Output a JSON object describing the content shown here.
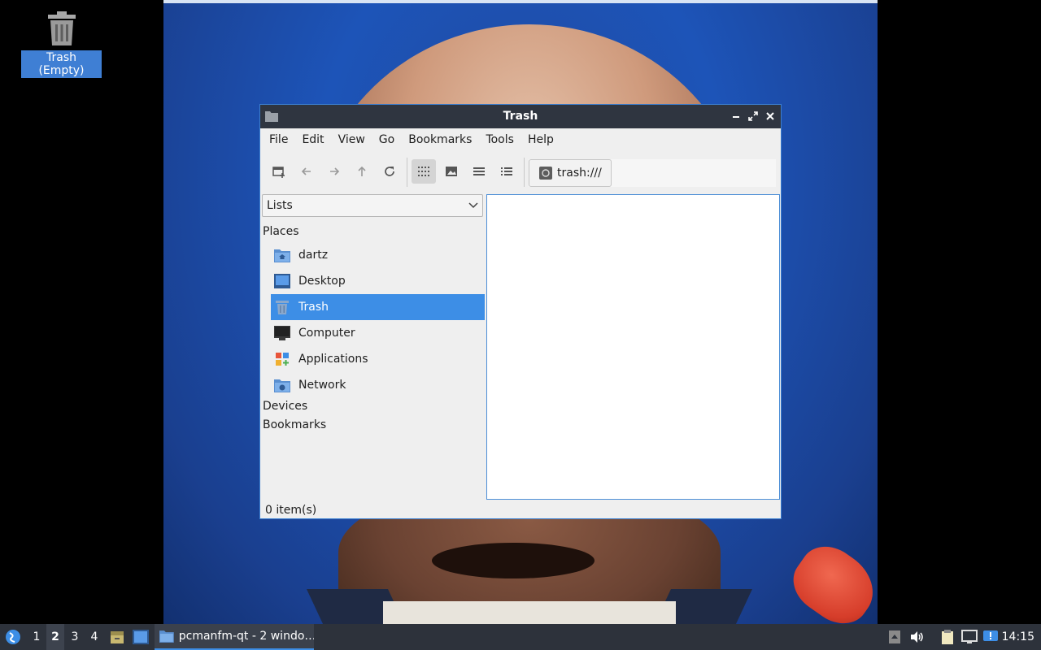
{
  "desktop": {
    "trash_icon_label": "Trash (Empty)"
  },
  "window": {
    "title": "Trash",
    "menu": [
      "File",
      "Edit",
      "View",
      "Go",
      "Bookmarks",
      "Tools",
      "Help"
    ],
    "address": "trash:///",
    "side_panel": {
      "view_select": "Lists",
      "places_heading": "Places",
      "places": [
        {
          "label": "dartz",
          "icon": "home-folder-icon"
        },
        {
          "label": "Desktop",
          "icon": "desktop-icon"
        },
        {
          "label": "Trash",
          "icon": "trash-icon",
          "selected": true
        },
        {
          "label": "Computer",
          "icon": "computer-icon"
        },
        {
          "label": "Applications",
          "icon": "applications-icon"
        },
        {
          "label": "Network",
          "icon": "network-folder-icon"
        }
      ],
      "devices_heading": "Devices",
      "bookmarks_heading": "Bookmarks"
    },
    "status": "0 item(s)"
  },
  "taskbar": {
    "desktops": [
      "1",
      "2",
      "3",
      "4"
    ],
    "current_desktop": "2",
    "task_label": "pcmanfm-qt - 2 windo…",
    "clock": "14:15"
  },
  "colors": {
    "accent": "#3d8ee6",
    "titlebar": "#2f3540",
    "taskbar": "#2d323b"
  }
}
